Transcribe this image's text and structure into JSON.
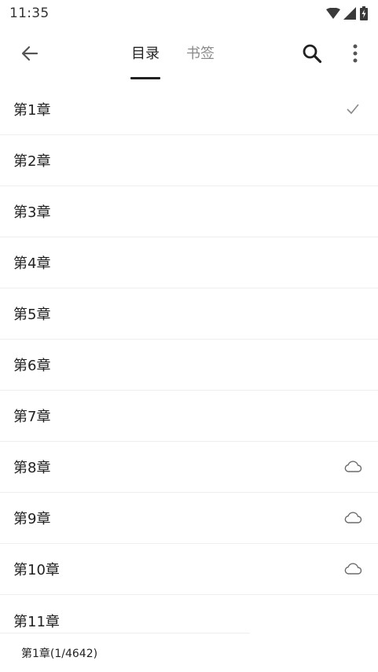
{
  "status": {
    "time": "11:35"
  },
  "toolbar": {
    "tabs": [
      {
        "label": "目录",
        "active": true
      },
      {
        "label": "书签",
        "active": false
      }
    ],
    "accent": "#212121",
    "inactive_color": "#8a8a8a"
  },
  "chapters": [
    {
      "title": "第1章",
      "icon": "check-icon"
    },
    {
      "title": "第2章",
      "icon": ""
    },
    {
      "title": "第3章",
      "icon": ""
    },
    {
      "title": "第4章",
      "icon": ""
    },
    {
      "title": "第5章",
      "icon": ""
    },
    {
      "title": "第6章",
      "icon": ""
    },
    {
      "title": "第7章",
      "icon": ""
    },
    {
      "title": "第8章",
      "icon": "cloud-icon"
    },
    {
      "title": "第9章",
      "icon": "cloud-icon"
    },
    {
      "title": "第10章",
      "icon": "cloud-icon"
    },
    {
      "title": "第11章",
      "icon": ""
    }
  ],
  "footer": {
    "position": "第1章(1/4642)"
  }
}
